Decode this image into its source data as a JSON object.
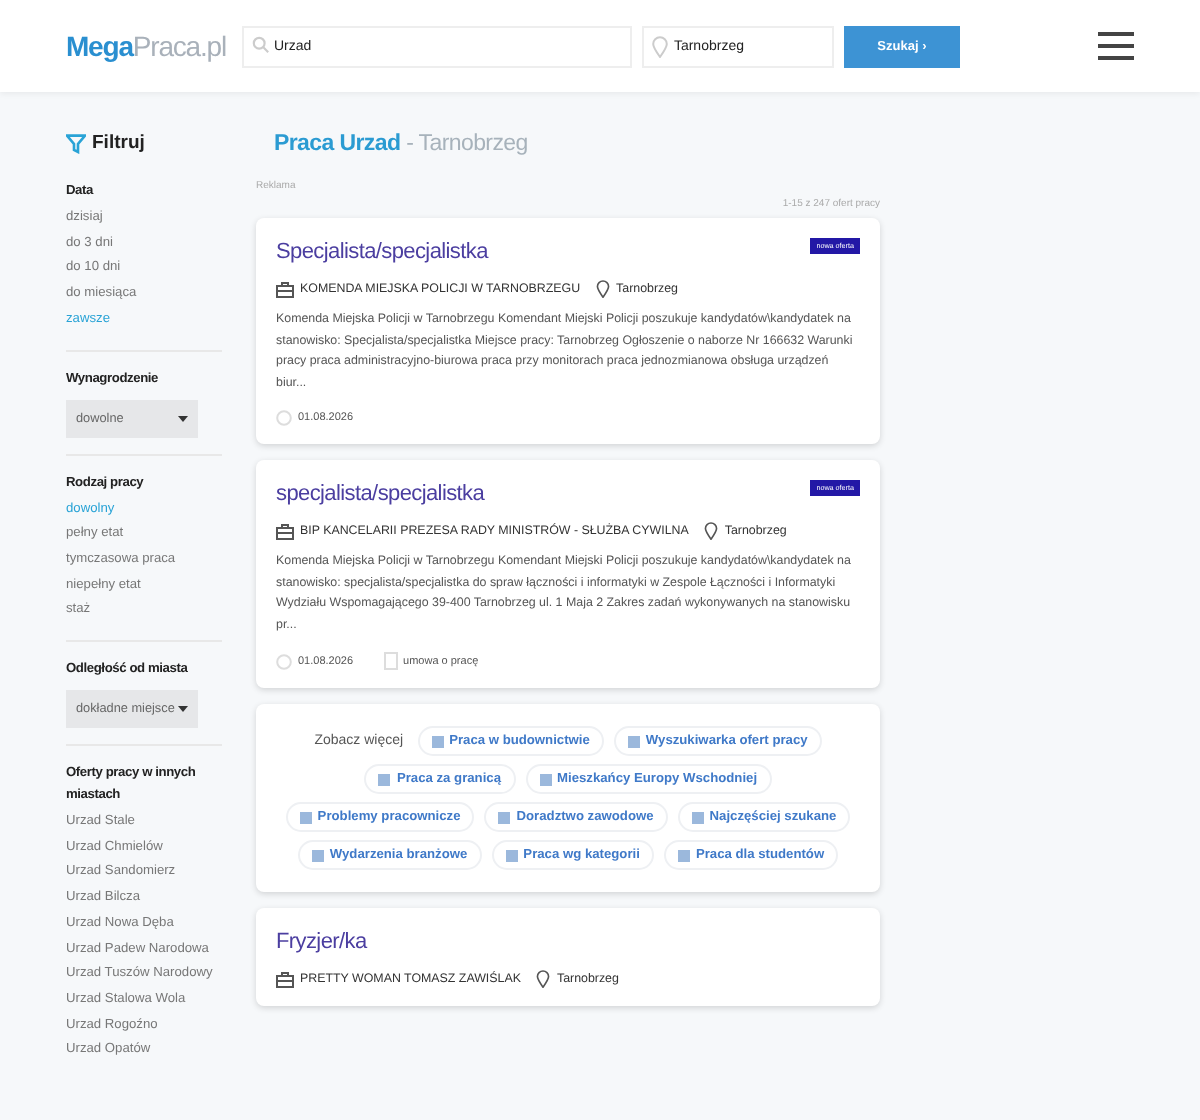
{
  "header": {
    "logo_first": "Mega",
    "logo_second": "Praca.pl",
    "search": {
      "value": "Urzad"
    },
    "location": {
      "value": "Tarnobrzeg"
    },
    "search_button": "Szukaj ›"
  },
  "sidebar": {
    "title": "Filtruj",
    "date": {
      "heading": "Data",
      "options": [
        {
          "label": "dzisiaj",
          "selected": false
        },
        {
          "label": "do 3 dni",
          "selected": false
        },
        {
          "label": "do 10 dni",
          "selected": false
        },
        {
          "label": "do miesiąca",
          "selected": false
        },
        {
          "label": "zawsze",
          "selected": true
        }
      ]
    },
    "salary": {
      "heading": "Wynagrodzenie",
      "value": "dowolne"
    },
    "job_type": {
      "heading": "Rodzaj pracy",
      "options": [
        {
          "label": "dowolny",
          "selected": true
        },
        {
          "label": "pełny etat",
          "selected": false
        },
        {
          "label": "tymczasowa praca",
          "selected": false
        },
        {
          "label": "niepełny etat",
          "selected": false
        },
        {
          "label": "staż",
          "selected": false
        }
      ]
    },
    "distance": {
      "heading": "Odległość od miasta",
      "value": "dokładne miejsce"
    },
    "other_cities": {
      "heading": "Oferty pracy w innych miastach",
      "links": [
        "Urzad Stale",
        "Urzad Chmielów",
        "Urzad Sandomierz",
        "Urzad Bilcza",
        "Urzad Nowa Dęba",
        "Urzad Padew Narodowa",
        "Urzad Tuszów Narodowy",
        "Urzad Stalowa Wola",
        "Urzad Rogoźno",
        "Urzad Opatów"
      ]
    }
  },
  "main": {
    "title_strong": "Praca Urzad",
    "title_rest": "- Tarnobrzeg",
    "ad_label": "Reklama",
    "count": "1-15 z 247 ofert pracy",
    "items": [
      {
        "kind": "offer",
        "title": "Specjalista/specjalistka",
        "badge": "nowa oferta",
        "company": "KOMENDA MIEJSKA POLICJI W TARNOBRZEGU",
        "location": "Tarnobrzeg",
        "description": "Komenda Miejska Policji w Tarnobrzegu Komendant Miejski Policji poszukuje kandydatów\\kandydatek na stanowisko: Specjalista/specjalistka Miejsce pracy: Tarnobrzeg Ogłoszenie o naborze Nr 166632 Warunki pracy praca administracyjno-biurowa praca przy monitorach praca jednozmianowa obsługa urządzeń biur...",
        "date": "01.08.2026"
      },
      {
        "kind": "offer",
        "title": "specjalista/specjalistka",
        "badge": "nowa oferta",
        "company": "BIP KANCELARII PREZESA RADY MINISTRÓW - SŁUŻBA CYWILNA",
        "location": "Tarnobrzeg",
        "description": "Komenda Miejska Policji w Tarnobrzegu Komendant Miejski Policji poszukuje kandydatów\\kandydatek na stanowisko: specjalista/specjalistka do spraw łączności i informatyki w Zespole Łączności i Informatyki Wydziału Wspomagającego 39-400 Tarnobrzeg ul. 1 Maja 2 Zakres zadań wykonywanych na stanowisku pr...",
        "date": "01.08.2026",
        "contract": "umowa o pracę"
      },
      {
        "kind": "more",
        "label": "Zobacz więcej",
        "links": [
          "Praca w budownictwie",
          "Wyszukiwarka ofert pracy",
          "Praca za granicą",
          "Mieszkańcy Europy Wschodniej",
          "Problemy pracownicze",
          "Doradztwo zawodowe",
          "Najczęściej szukane",
          "Wydarzenia branżowe",
          "Praca wg kategorii",
          "Praca dla studentów"
        ]
      },
      {
        "kind": "offer",
        "title": "Fryzjer/ka",
        "company": "PRETTY WOMAN TOMASZ ZAWIŚLAK",
        "location": "Tarnobrzeg"
      }
    ]
  }
}
